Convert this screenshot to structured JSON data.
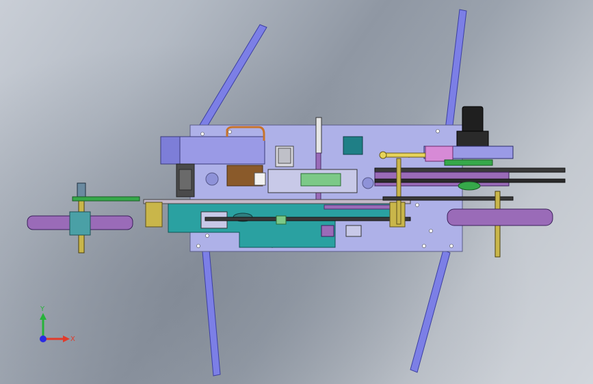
{
  "viewport": {
    "background_colors": [
      "#c9ced6",
      "#8f97a3",
      "#d2d6dc"
    ]
  },
  "model": {
    "part_colors": {
      "frame_plate": "#aeb1e8",
      "leg": "#7c7fe6",
      "teal_plate": "#2aa1a1",
      "wheel_purple": "#9a6bb8",
      "olive": "#c9b64a",
      "rod_dark": "#3a3a3a",
      "motor_black": "#1f1f1f",
      "pink": "#d78ad6",
      "green": "#36a84a",
      "brown_block": "#8a5a2a"
    }
  },
  "triad": {
    "x_label": "X",
    "y_label": "Y",
    "colors": {
      "x": "#e23a2a",
      "y": "#27b33a",
      "z": "#2a2ae2"
    }
  }
}
